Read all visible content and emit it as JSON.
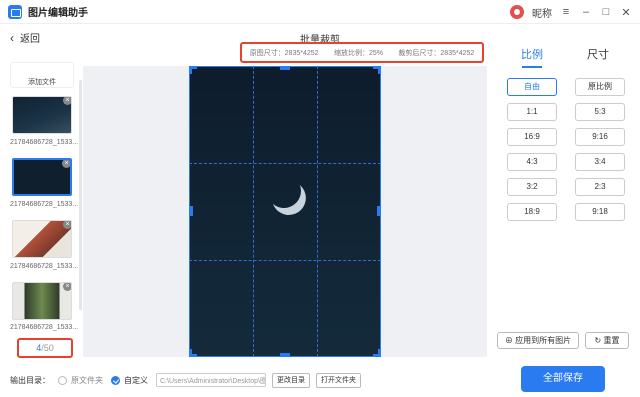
{
  "app": {
    "title": "图片编辑助手",
    "user_label": "昵称"
  },
  "nav": {
    "back_label": "返回"
  },
  "page": {
    "title": "批量裁剪"
  },
  "info": {
    "original_size": "原图尺寸：2835*4252",
    "scale": "缩放比例：25%",
    "cropped_size": "裁剪后尺寸：2835*4252"
  },
  "sidebar": {
    "add_label": "添加文件",
    "items": [
      {
        "label": "21784686728_1533..."
      },
      {
        "label": "21784686728_1533..."
      },
      {
        "label": "21784686728_1533..."
      },
      {
        "label": "21784686728_1533..."
      }
    ],
    "counter_current": "4",
    "counter_total": "/50"
  },
  "panel": {
    "tab_ratio": "比例",
    "tab_size": "尺寸",
    "ratios": [
      "自由",
      "原比例",
      "1:1",
      "5:3",
      "16:9",
      "9:16",
      "4:3",
      "3:4",
      "3:2",
      "2:3",
      "18:9",
      "9:18"
    ],
    "apply_all": "应用到所有图片",
    "reset": "重置"
  },
  "bottom": {
    "output_label": "输出目录：",
    "opt_source": "原文件夹",
    "opt_custom": "自定义",
    "path": "C:\\Users\\Administrator\\Desktop\\图",
    "change_dir": "更改目录",
    "open_folder": "打开文件夹",
    "save_all": "全部保存"
  }
}
